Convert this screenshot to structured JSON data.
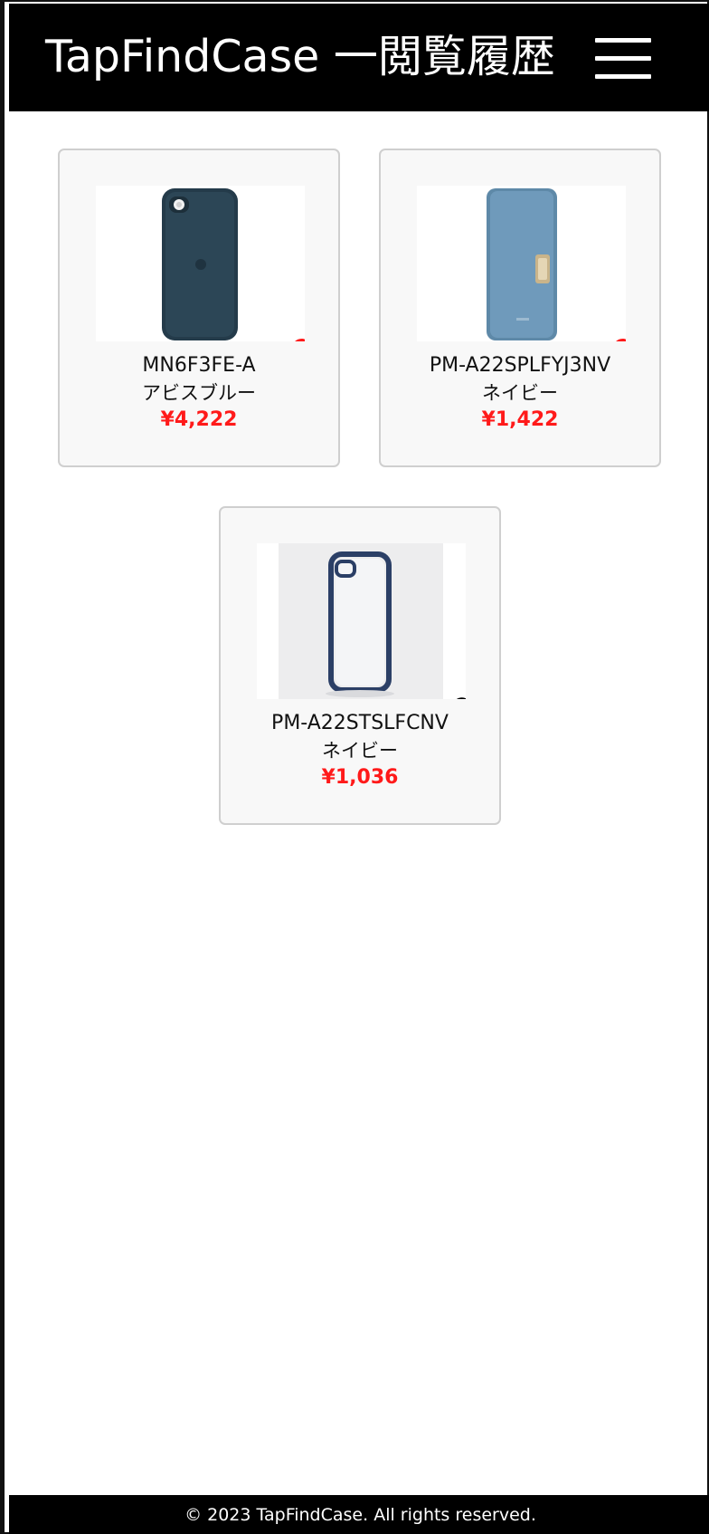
{
  "header": {
    "title": "TapFindCase 一閲覧履歴",
    "menu_icon": "hamburger-menu-icon"
  },
  "colors": {
    "header_bg": "#000000",
    "price": "#ff1a1a",
    "heart_favorite": "#ff1a1a",
    "card_bg": "#f8f8f8",
    "card_border": "#cfcfcf"
  },
  "products": [
    {
      "model": "MN6F3FE-A",
      "color_name": "アビスブルー",
      "price": "¥4,222",
      "favorited": true,
      "image_icon": "phone-case-silicone-image"
    },
    {
      "model": "PM-A22SPLFYJ3NV",
      "color_name": "ネイビー",
      "price": "¥1,422",
      "favorited": true,
      "image_icon": "phone-case-folio-image"
    },
    {
      "model": "PM-A22STSLFCNV",
      "color_name": "ネイビー",
      "price": "¥1,036",
      "favorited": false,
      "image_icon": "phone-case-clear-bumper-image"
    }
  ],
  "footer": {
    "text": "© 2023 TapFindCase. All rights reserved."
  }
}
